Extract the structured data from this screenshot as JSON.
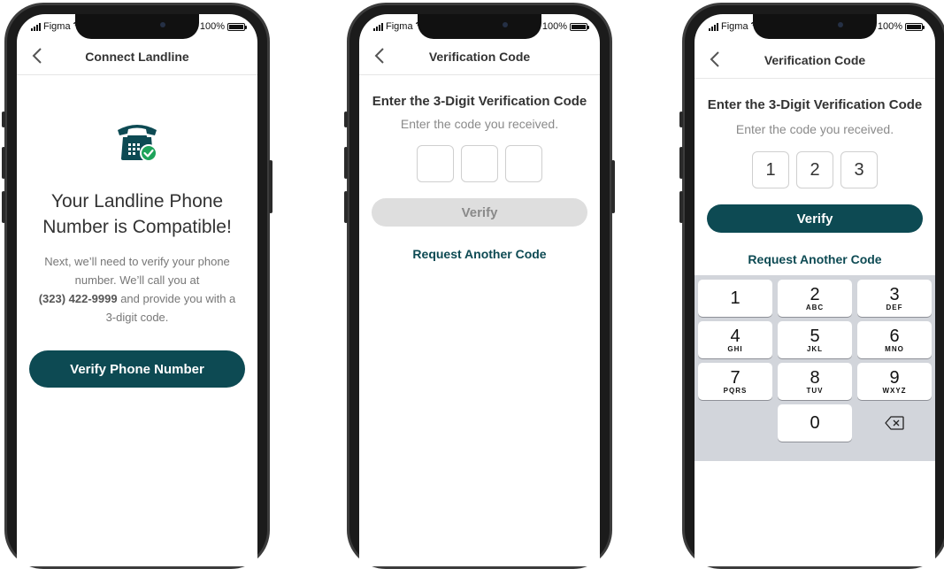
{
  "status": {
    "carrier": "Figma",
    "battery": "100%"
  },
  "screen1": {
    "title": "Connect Landline",
    "heading_line1": "Your Landline Phone",
    "heading_line2": "Number is Compatible!",
    "body_line1": "Next, we’ll need to verify your phone",
    "body_line2": "number. We’ll call you at",
    "phone": "(323) 422-9999",
    "body_line3_rest": " and provide you with a",
    "body_line4": "3-digit code.",
    "button": "Verify Phone Number"
  },
  "screen2": {
    "title": "Verification Code",
    "heading": "Enter the 3-Digit Verification Code",
    "subtext": "Enter the code you received.",
    "digits": [
      "",
      "",
      ""
    ],
    "button": "Verify",
    "link": "Request Another Code"
  },
  "screen3": {
    "title": "Verification Code",
    "heading": "Enter the 3-Digit Verification Code",
    "subtext": "Enter the code you received.",
    "digits": [
      "1",
      "2",
      "3"
    ],
    "button": "Verify",
    "link": "Request Another Code",
    "keys": [
      {
        "d": "1",
        "s": ""
      },
      {
        "d": "2",
        "s": "ABC"
      },
      {
        "d": "3",
        "s": "DEF"
      },
      {
        "d": "4",
        "s": "GHI"
      },
      {
        "d": "5",
        "s": "JKL"
      },
      {
        "d": "6",
        "s": "MNO"
      },
      {
        "d": "7",
        "s": "PQRS"
      },
      {
        "d": "8",
        "s": "TUV"
      },
      {
        "d": "9",
        "s": "WXYZ"
      },
      {
        "d": "0",
        "s": ""
      }
    ]
  },
  "colors": {
    "accent": "#0d4a53",
    "success": "#1ea35a",
    "disabled": "#dedede"
  },
  "icons": {
    "back": "chevron-left-icon",
    "phone": "landline-check-icon",
    "delete": "backspace-icon"
  }
}
